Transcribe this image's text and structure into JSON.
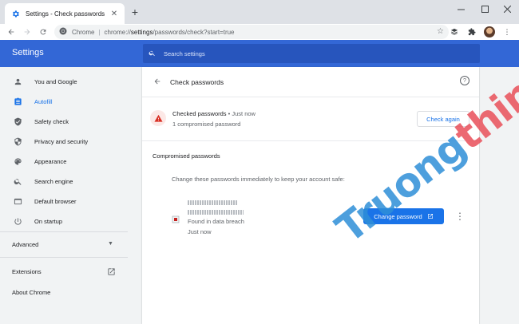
{
  "browser": {
    "tab_title": "Settings - Check passwords",
    "omnibox_site": "Chrome",
    "url_prefix": "chrome://",
    "url_host": "settings",
    "url_path": "/passwords/check?start=true"
  },
  "settings": {
    "title": "Settings",
    "search_placeholder": "Search settings",
    "sidebar": {
      "items": [
        {
          "label": "You and Google",
          "icon": "person-icon"
        },
        {
          "label": "Autofill",
          "icon": "clipboard-icon"
        },
        {
          "label": "Safety check",
          "icon": "shield-icon"
        },
        {
          "label": "Privacy and security",
          "icon": "lock-shield-icon"
        },
        {
          "label": "Appearance",
          "icon": "palette-icon"
        },
        {
          "label": "Search engine",
          "icon": "search-icon"
        },
        {
          "label": "Default browser",
          "icon": "browser-icon"
        },
        {
          "label": "On startup",
          "icon": "power-icon"
        }
      ],
      "advanced": "Advanced",
      "extensions": "Extensions",
      "about": "About Chrome"
    }
  },
  "page": {
    "title": "Check passwords",
    "status_title": "Checked passwords",
    "status_time": "• Just now",
    "status_sub": "1 compromised password",
    "check_again": "Check again",
    "section_title": "Compromised passwords",
    "explanation": "Change these passwords immediately to keep your account safe:",
    "entry": {
      "reason": "Found in data breach",
      "time": "Just now"
    },
    "change_button": "Change password"
  },
  "watermark": {
    "part1": "Truong",
    "part2": "thin.top"
  },
  "colors": {
    "accent": "#1a73e8",
    "header": "#3367d6",
    "warning": "#d93025"
  }
}
